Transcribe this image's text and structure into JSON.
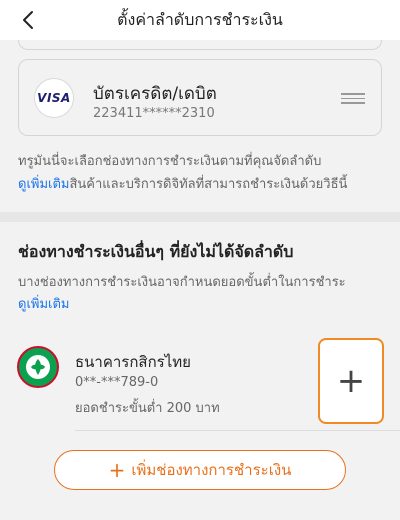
{
  "header": {
    "title": "ตั้งค่าลำดับการชำระเงิน",
    "back_icon": "chevron-left-icon"
  },
  "prioritized": {
    "cards": [
      {
        "brand": "VISA",
        "name": "บัตรเครดิต/เดบิต",
        "number": "223411******2310",
        "icon": "drag-handle-icon"
      }
    ],
    "note_text": "ทรูมันนี่จะเลือกช่องทางการชำระเงินตามที่คุณจัดลำดับ",
    "note_link": "ดูเพิ่มเติม",
    "note_text2": "สินค้าและบริการดิจิทัลที่สามารถชำระเงินด้วยวิธีนี้"
  },
  "others": {
    "title": "ช่องทางชำระเงินอื่นๆ ที่ยังไม่ได้จัดลำดับ",
    "desc": "บางช่องทางการชำระเงินอาจกำหนดยอดขั้นต่ำในการชำระ",
    "desc_link": "ดูเพิ่มเติม",
    "items": [
      {
        "name": "ธนาคารกสิกรไทย",
        "account": "0**-***789-0",
        "min": "ยอดชำระขั้นต่ำ 200 บาท",
        "add_icon": "plus-icon"
      }
    ],
    "add_button": "เพิ่มช่องทางการชำระเงิน"
  },
  "colors": {
    "accent": "#e8701a",
    "link": "#1a73e8",
    "kbank_green": "#0aa14f"
  }
}
